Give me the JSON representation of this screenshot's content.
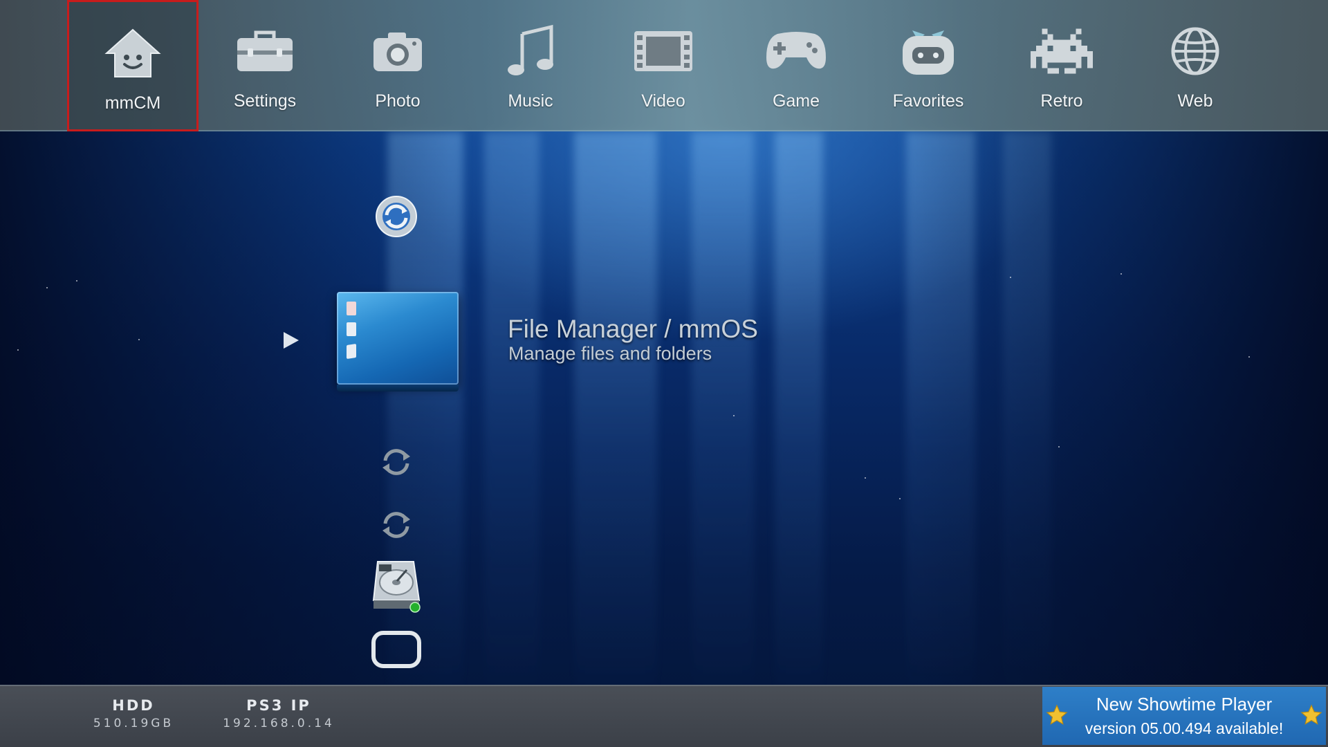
{
  "top_menu": {
    "selected_index": 0,
    "items": [
      {
        "label": "mmCM",
        "icon": "home-face-icon"
      },
      {
        "label": "Settings",
        "icon": "toolbox-icon"
      },
      {
        "label": "Photo",
        "icon": "camera-icon"
      },
      {
        "label": "Music",
        "icon": "music-note-icon"
      },
      {
        "label": "Video",
        "icon": "film-strip-icon"
      },
      {
        "label": "Game",
        "icon": "gamepad-icon"
      },
      {
        "label": "Favorites",
        "icon": "robot-face-icon"
      },
      {
        "label": "Retro",
        "icon": "space-invader-icon"
      },
      {
        "label": "Web",
        "icon": "globe-icon"
      }
    ]
  },
  "column": {
    "items": [
      {
        "icon": "refresh-circle-icon"
      },
      {
        "icon": "file-manager-icon"
      },
      {
        "icon": "refresh-arrows-icon"
      },
      {
        "icon": "refresh-arrows-icon"
      },
      {
        "icon": "hard-drive-icon"
      },
      {
        "icon": "rounded-frame-icon"
      }
    ],
    "selected": {
      "title": "File Manager / mmOS",
      "subtitle": "Manage files and folders"
    }
  },
  "status": {
    "hdd_label": "HDD",
    "hdd_value": "510.19GB",
    "ip_label": "PS3 IP",
    "ip_value": "192.168.0.14"
  },
  "notification": {
    "line1": "New Showtime Player",
    "line2": "version 05.00.494 available!"
  },
  "colors": {
    "selection_border": "#c81c1c",
    "notification_bg": "#2a77c2",
    "star": "#f0c030"
  }
}
